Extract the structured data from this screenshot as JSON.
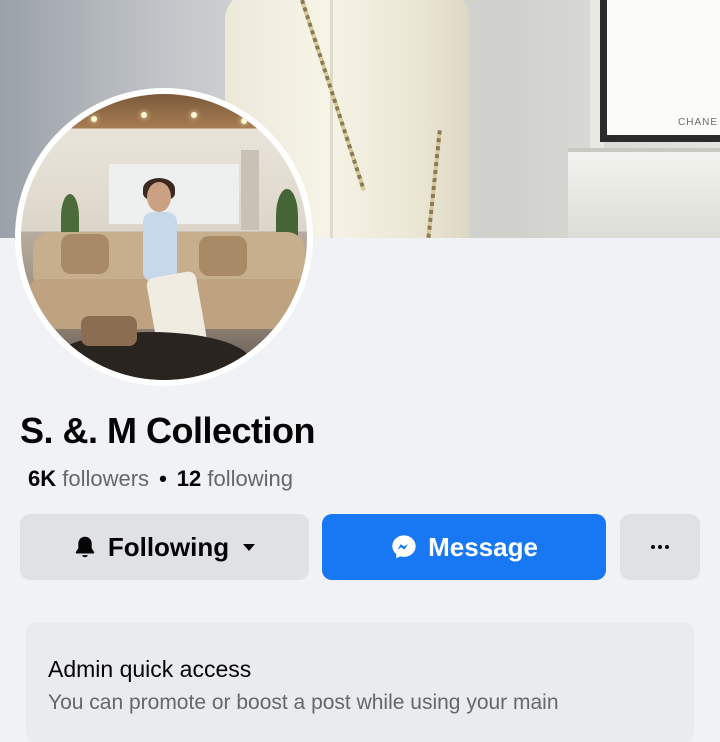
{
  "cover": {
    "frame_brand_text": "CHANE"
  },
  "profile": {
    "page_name": "S. &. M Collection",
    "followers_count": "6K",
    "followers_label": "followers",
    "separator": "•",
    "following_count": "12",
    "following_label": "following"
  },
  "actions": {
    "following_label": "Following",
    "following_icon": "bell-icon",
    "following_caret_icon": "caret-down-icon",
    "message_label": "Message",
    "message_icon": "messenger-icon",
    "more_icon": "more-horizontal-icon"
  },
  "admin": {
    "title": "Admin quick access",
    "description": "You can promote or boost a post while using your main"
  },
  "colors": {
    "primary_blue": "#1877f2",
    "secondary_button": "#dfe1e5",
    "page_background": "#f0f2f5",
    "muted_text": "#65676b"
  }
}
